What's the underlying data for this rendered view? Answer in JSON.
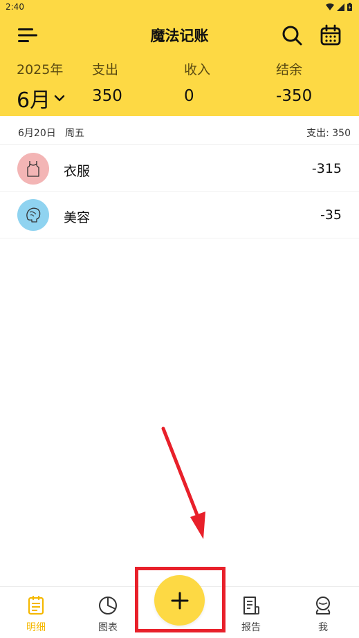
{
  "status_bar": {
    "time": "2:40"
  },
  "header": {
    "title": "魔法记账"
  },
  "summary": {
    "year": "2025年",
    "month": "6月",
    "expense_label": "支出",
    "expense_value": "350",
    "income_label": "收入",
    "income_value": "0",
    "balance_label": "结余",
    "balance_value": "-350"
  },
  "day_group": {
    "date": "6月20日",
    "weekday": "周五",
    "total": "支出: 350",
    "records": [
      {
        "category": "衣服",
        "amount": "-315",
        "icon": "clothes-icon",
        "icon_bg": "#f3b5b5"
      },
      {
        "category": "美容",
        "amount": "-35",
        "icon": "beauty-icon",
        "icon_bg": "#8fd3f0"
      }
    ]
  },
  "bottom_nav": {
    "items": [
      {
        "label": "明细",
        "icon": "details-icon",
        "active": true
      },
      {
        "label": "图表",
        "icon": "chart-icon",
        "active": false
      },
      {
        "label": "报告",
        "icon": "report-icon",
        "active": false
      },
      {
        "label": "我",
        "icon": "profile-icon",
        "active": false
      }
    ],
    "add_icon": "plus-icon"
  },
  "colors": {
    "accent": "#fdd944",
    "active_nav": "#f5b800",
    "annotation": "#e8202a"
  }
}
